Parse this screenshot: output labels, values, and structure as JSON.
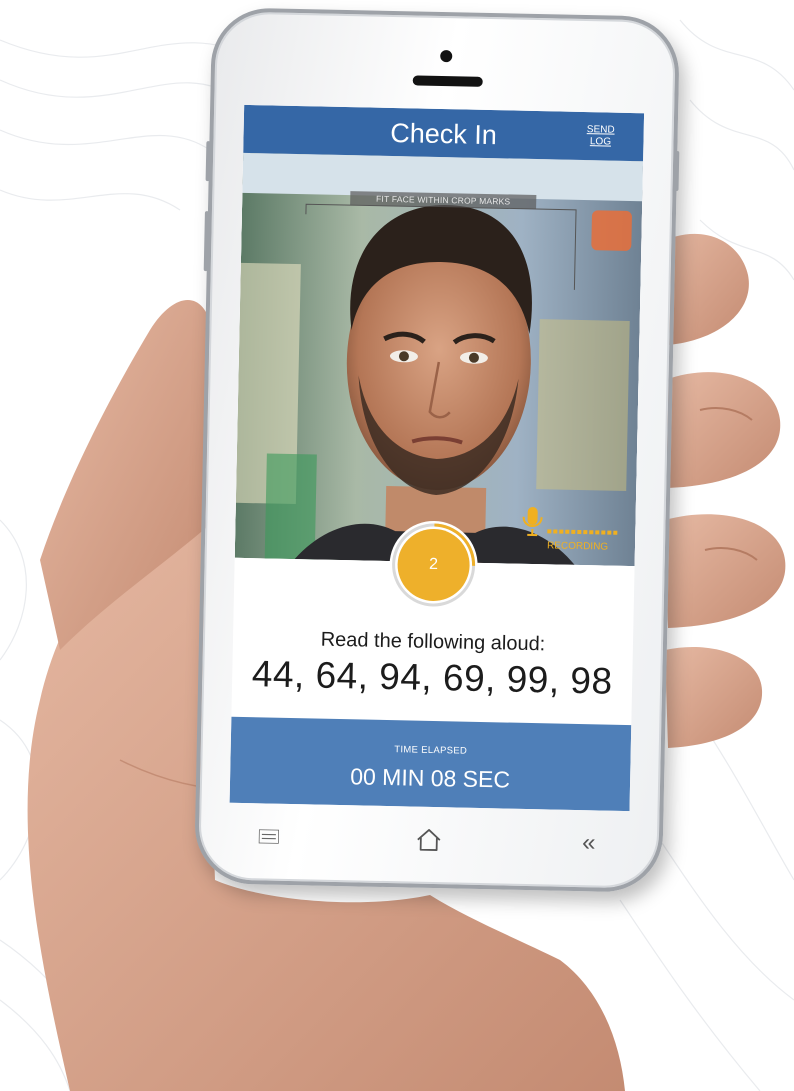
{
  "app": {
    "title": "Check In",
    "send_log_label_line1": "SEND",
    "send_log_label_line2": "LOG"
  },
  "camera": {
    "guide_label": "FIT FACE WITHIN CROP MARKS",
    "recording_label": "RECORDING"
  },
  "countdown": {
    "value": "2"
  },
  "prompt": {
    "instruction": "Read the following aloud:",
    "digits": "44, 64, 94, 69, 99, 98"
  },
  "elapsed": {
    "label": "TIME ELAPSED",
    "value": "00 MIN  08 SEC"
  },
  "navbar": {
    "menu_icon": "menu-icon",
    "home_icon": "home-icon",
    "back_icon": "back-icon",
    "back_glyph": "«"
  },
  "colors": {
    "header": "#3567a6",
    "elapsed_bar": "#4f7fb8",
    "accent": "#eeb02b"
  }
}
